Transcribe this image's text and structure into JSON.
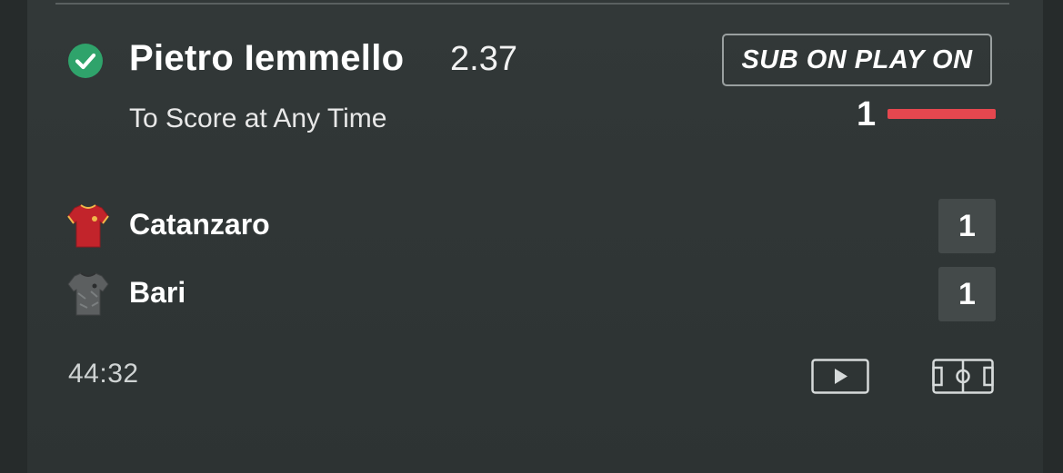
{
  "selection": {
    "player": "Pietro Iemmello",
    "odds": "2.37",
    "market": "To Score at Any Time",
    "status_icon": "check-circle-icon"
  },
  "sub_on_play_on": {
    "label": "SUB ON PLAY ON",
    "count": "1",
    "bar_color": "#e5474f"
  },
  "match": {
    "home": {
      "name": "Catanzaro",
      "score": "1",
      "shirt_icon": "red-shirt-icon",
      "shirt_color": "#c2242b"
    },
    "away": {
      "name": "Bari",
      "score": "1",
      "shirt_icon": "grey-shirt-icon",
      "shirt_color": "#5c5f60"
    },
    "clock": "44:32"
  },
  "actions": {
    "video_icon": "play-video-icon",
    "pitch_icon": "pitch-view-icon"
  },
  "colors": {
    "background": "#262b2b",
    "card": "#323838",
    "check_green": "#2fa36b",
    "score_box": "#444a4a"
  }
}
